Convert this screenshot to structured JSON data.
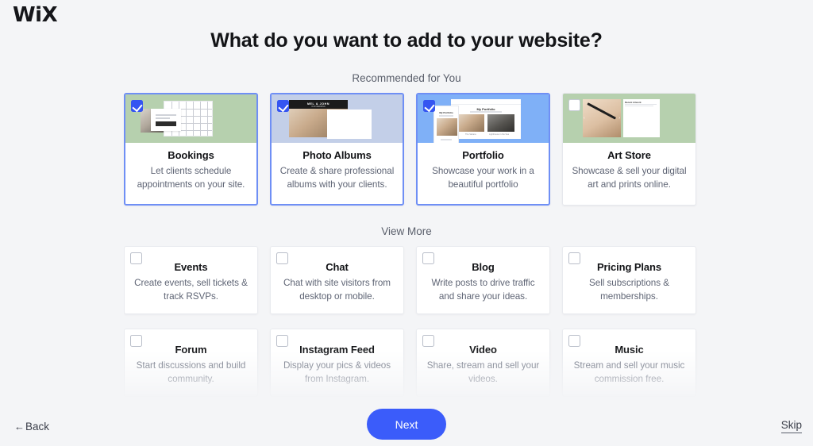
{
  "brand": {
    "logo_text": "WiX",
    "accent_color": "#3b5cfa",
    "selected_border_color": "#6f8ff5",
    "page_bg": "#f4f5f7"
  },
  "header": {
    "title": "What do you want to add to your website?"
  },
  "sections": {
    "recommended_label": "Recommended for You",
    "view_more_label": "View More"
  },
  "recommended": [
    {
      "title": "Bookings",
      "desc": "Let clients schedule appointments on your site.",
      "selected": true,
      "thumb_bg": "#b6d0ae",
      "thumb_kind": "bookings"
    },
    {
      "title": "Photo Albums",
      "desc": "Create & share professional albums with your clients.",
      "selected": true,
      "thumb_bg": "#c3cfe8",
      "thumb_kind": "photo-albums",
      "thumb_text": {
        "name": "MEL & JOHN",
        "sub": "OUR WEDDING"
      }
    },
    {
      "title": "Portfolio",
      "desc": "Showcase your work in a beautiful portfolio",
      "selected": true,
      "thumb_bg": "#7fb0f7",
      "thumb_kind": "portfolio",
      "thumb_text": {
        "name": "My Portfolio",
        "cap1": "The Sahara",
        "cap2": "Lighthouse in the Sea"
      }
    },
    {
      "title": "Art Store",
      "desc": "Showcase & sell your digital art and prints online.",
      "selected": false,
      "thumb_bg": "#b6d0ae",
      "thumb_kind": "art-store",
      "thumb_text": {
        "name": "Recent Artwork"
      }
    }
  ],
  "view_more": [
    {
      "title": "Events",
      "desc": "Create events, sell tickets & track RSVPs.",
      "selected": false
    },
    {
      "title": "Chat",
      "desc": "Chat with site visitors from desktop or mobile.",
      "selected": false
    },
    {
      "title": "Blog",
      "desc": "Write posts to drive traffic and share your ideas.",
      "selected": false
    },
    {
      "title": "Pricing Plans",
      "desc": "Sell subscriptions & memberships.",
      "selected": false
    },
    {
      "title": "Forum",
      "desc": "Start discussions and build community.",
      "selected": false
    },
    {
      "title": "Instagram Feed",
      "desc": "Display your pics & videos from Instagram.",
      "selected": false
    },
    {
      "title": "Video",
      "desc": "Share, stream and sell your videos.",
      "selected": false
    },
    {
      "title": "Music",
      "desc": "Stream and sell your music commission free.",
      "selected": false
    }
  ],
  "footer": {
    "back_label": "Back",
    "back_arrow": "←",
    "next_label": "Next",
    "skip_label": "Skip"
  }
}
